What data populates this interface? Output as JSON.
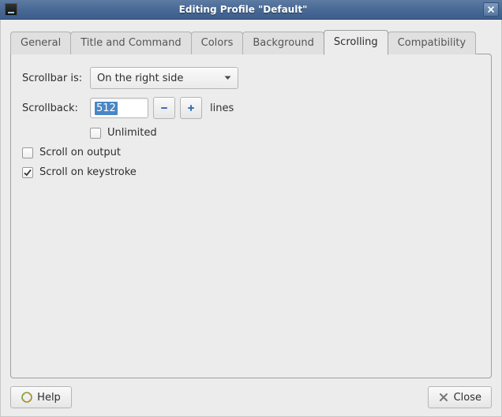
{
  "window": {
    "title": "Editing Profile \"Default\""
  },
  "tabs": [
    {
      "label": "General"
    },
    {
      "label": "Title and Command"
    },
    {
      "label": "Colors"
    },
    {
      "label": "Background"
    },
    {
      "label": "Scrolling"
    },
    {
      "label": "Compatibility"
    }
  ],
  "active_tab_index": 4,
  "scrolling": {
    "scrollbar_is_label": "Scrollbar is:",
    "scrollbar_mode": "On the right side",
    "scrollback_label": "Scrollback:",
    "scrollback_value": "512",
    "scrollback_suffix": "lines",
    "unlimited_label": "Unlimited",
    "unlimited_checked": false,
    "scroll_on_output_label": "Scroll on output",
    "scroll_on_output_checked": false,
    "scroll_on_keystroke_label": "Scroll on keystroke",
    "scroll_on_keystroke_checked": true
  },
  "buttons": {
    "help": "Help",
    "close": "Close"
  }
}
